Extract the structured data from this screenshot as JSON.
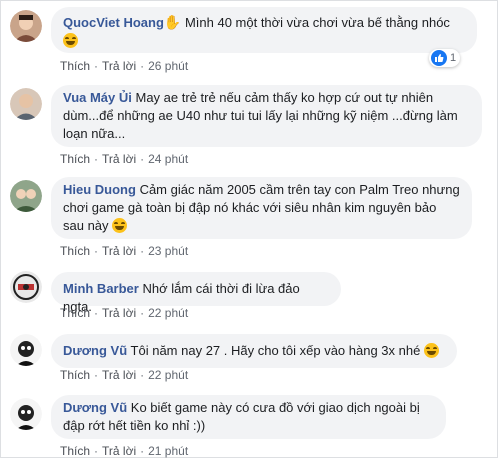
{
  "actions": {
    "like": "Thích",
    "reply": "Trả lời",
    "sep": "·"
  },
  "colors": {
    "author": "#385898",
    "bubble": "#f2f3f5",
    "like_blue": "#1877f2"
  },
  "comments": [
    {
      "author": "QuocViet Hoang",
      "text": "Mình 40 một thời vừa chơi vừa bế thằng nhóc",
      "time": "26 phút",
      "likes": "1"
    },
    {
      "author": "Vua Máy Ủi",
      "text": "May ae trẻ trẻ nếu cảm thấy ko hợp cứ out tự nhiên dùm...để những ae U40 như tui tui lấy lại những kỹ niệm ...đừng làm loạn nữa...",
      "time": "24 phút"
    },
    {
      "author": "Hieu Duong",
      "text": "Cảm giác năm 2005 cầm trên tay con Palm Treo nhưng chơi game gà toàn bị đập nó khác với siêu nhân kim nguyên bảo sau này",
      "time": "23 phút"
    },
    {
      "author": "Minh Barber",
      "text": "Nhớ lắm cái thời đi lừa đảo ngta.",
      "time": "22 phút"
    },
    {
      "author": "Dương Vũ",
      "text": "Tôi năm nay 27 . Hãy cho tôi xếp vào hàng 3x nhé",
      "time": "22 phút"
    },
    {
      "author": "Dương Vũ",
      "text": "Ko biết game này có cưa đồ với giao dịch ngoài bị đập rớt hết tiền ko nhỉ :))",
      "time": "21 phút"
    }
  ]
}
